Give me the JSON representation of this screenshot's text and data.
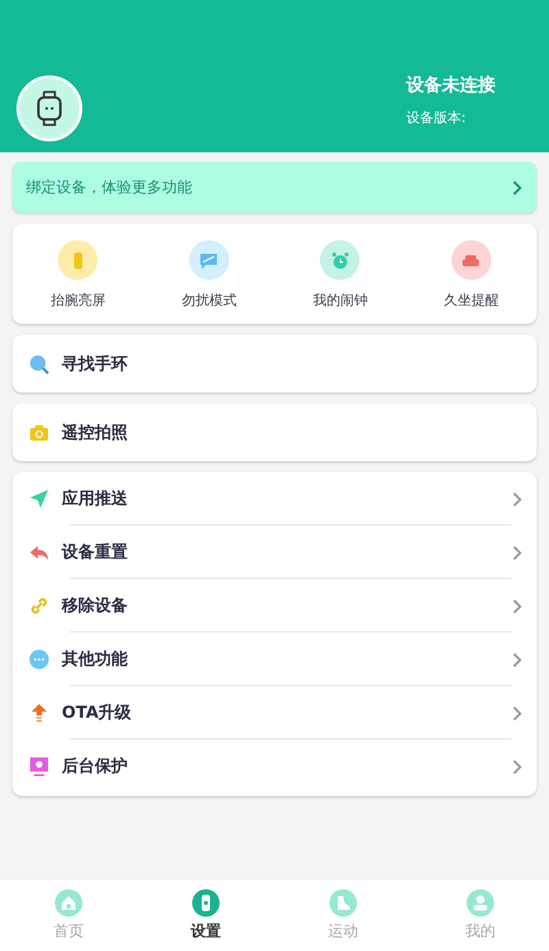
{
  "header": {
    "status": "设备未连接",
    "version_label": "设备版本:"
  },
  "banner": {
    "text": "绑定设备，体验更多功能"
  },
  "quick_actions": [
    {
      "label": "抬腕亮屏",
      "kind": "wrist",
      "color": "#fdecaa"
    },
    {
      "label": "勿扰模式",
      "kind": "dnd",
      "color": "#d3eefd"
    },
    {
      "label": "我的闹钟",
      "kind": "alarm",
      "color": "#c5f2e6"
    },
    {
      "label": "久坐提醒",
      "kind": "sofa",
      "color": "#fdd3d3"
    }
  ],
  "single_cards": [
    {
      "label": "寻找手环",
      "kind": "search"
    },
    {
      "label": "遥控拍照",
      "kind": "camera"
    }
  ],
  "menu": [
    {
      "label": "应用推送",
      "kind": "send"
    },
    {
      "label": "设备重置",
      "kind": "reset"
    },
    {
      "label": "移除设备",
      "kind": "link"
    },
    {
      "label": "其他功能",
      "kind": "more"
    },
    {
      "label": "OTA升级",
      "kind": "upgrade"
    },
    {
      "label": "后台保护",
      "kind": "protect"
    }
  ],
  "tabs": [
    {
      "label": "首页",
      "kind": "home",
      "selected": false
    },
    {
      "label": "设置",
      "kind": "watch",
      "selected": true
    },
    {
      "label": "运动",
      "kind": "shoe",
      "selected": false
    },
    {
      "label": "我的",
      "kind": "user",
      "selected": false
    }
  ]
}
